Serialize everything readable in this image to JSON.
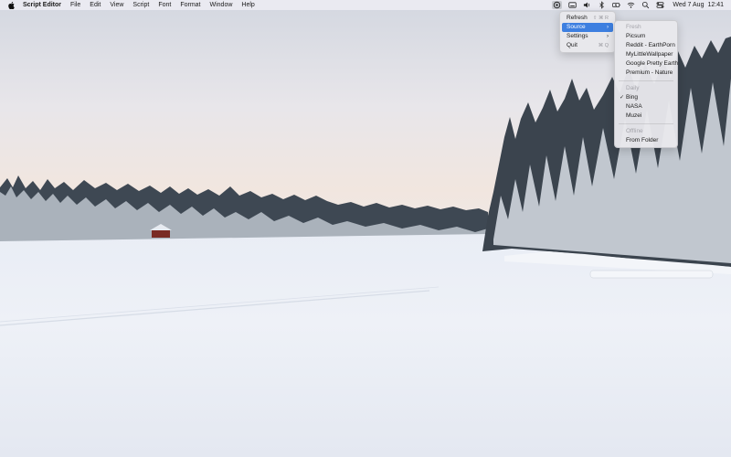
{
  "menubar": {
    "apple_icon": "apple-logo",
    "app_name": "Script Editor",
    "menus": [
      "File",
      "Edit",
      "View",
      "Script",
      "Font",
      "Format",
      "Window",
      "Help"
    ],
    "status_icons": [
      "wallpaper-app-icon",
      "keyboard-icon",
      "volume-icon",
      "bluetooth-icon",
      "battery-icon",
      "wifi-icon",
      "search-icon",
      "control-center-icon"
    ],
    "date": "Wed 7 Aug",
    "time": "12:41"
  },
  "app_menu": {
    "items": [
      {
        "label": "Refresh",
        "shortcut": "⇧ ⌘ R"
      },
      {
        "label": "Source",
        "selected": true
      },
      {
        "label": "Settings"
      },
      {
        "label": "Quit",
        "shortcut": "⌘ Q"
      }
    ]
  },
  "source_menu": {
    "fresh_header": "Fresh",
    "fresh": [
      "Picsum",
      "Reddit - EarthPorn",
      "MyLittleWallpaper",
      "Google Pretty Earth",
      "Premium - Nature"
    ],
    "daily_header": "Daily",
    "daily": [
      "Bing",
      "NASA",
      "Muzei"
    ],
    "checked": "Bing",
    "offline_header": "Offline",
    "offline": [
      "From Folder"
    ]
  },
  "colors": {
    "menu_highlight": "#3d7fe0",
    "menubar_bg": "#ececf2"
  }
}
